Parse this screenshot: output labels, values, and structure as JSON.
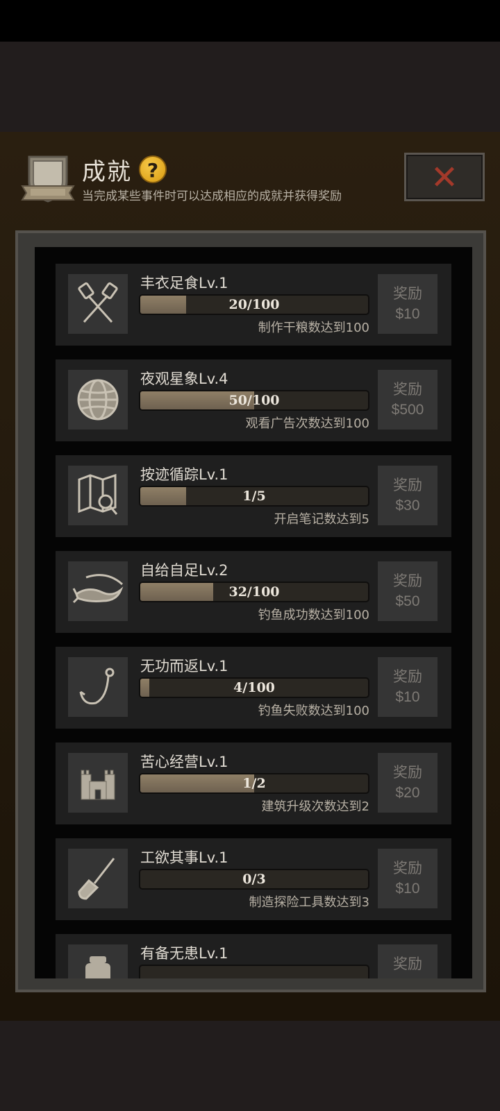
{
  "header": {
    "title": "成就",
    "help_icon": "?",
    "subtitle": "当完成某些事件时可以达成相应的成就并获得奖励",
    "close_label": "✕"
  },
  "achievements": [
    {
      "name": "丰衣足食Lv.1",
      "progress_text": "20/100",
      "progress": 0.2,
      "desc": "制作干粮数达到100",
      "reward_label": "奖励",
      "reward": "$10",
      "icon": "crossed-spatulas-icon"
    },
    {
      "name": "夜观星象Lv.4",
      "progress_text": "50/100",
      "progress": 0.5,
      "desc": "观看广告次数达到100",
      "reward_label": "奖励",
      "reward": "$500",
      "icon": "globe-icon"
    },
    {
      "name": "按迹循踪Lv.1",
      "progress_text": "1/5",
      "progress": 0.2,
      "desc": "开启笔记数达到5",
      "reward_label": "奖励",
      "reward": "$30",
      "icon": "map-search-icon"
    },
    {
      "name": "自给自足Lv.2",
      "progress_text": "32/100",
      "progress": 0.32,
      "desc": "钓鱼成功数达到100",
      "reward_label": "奖励",
      "reward": "$50",
      "icon": "fish-icon"
    },
    {
      "name": "无功而返Lv.1",
      "progress_text": "4/100",
      "progress": 0.04,
      "desc": "钓鱼失败数达到100",
      "reward_label": "奖励",
      "reward": "$10",
      "icon": "fishing-hook-icon"
    },
    {
      "name": "苦心经营Lv.1",
      "progress_text": "1/2",
      "progress": 0.5,
      "desc": "建筑升级次数达到2",
      "reward_label": "奖励",
      "reward": "$20",
      "icon": "castle-icon"
    },
    {
      "name": "工欲其事Lv.1",
      "progress_text": "0/3",
      "progress": 0.0,
      "desc": "制造探险工具数达到3",
      "reward_label": "奖励",
      "reward": "$10",
      "icon": "shovel-icon"
    },
    {
      "name": "有备无患Lv.1",
      "progress_text": "",
      "progress": 0.0,
      "desc": "",
      "reward_label": "奖励",
      "reward": "",
      "icon": "jar-icon"
    }
  ]
}
